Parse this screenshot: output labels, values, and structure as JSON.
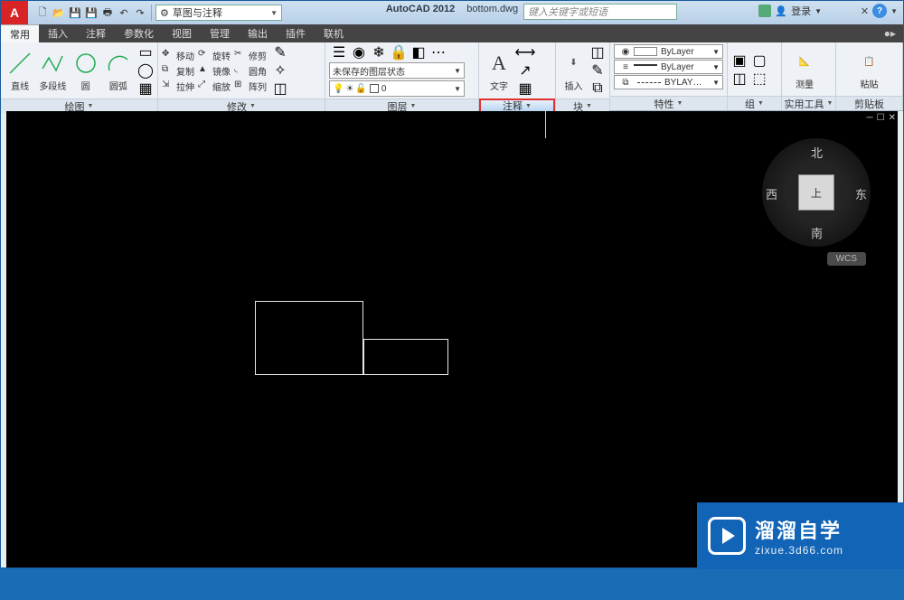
{
  "app": {
    "name": "AutoCAD 2012",
    "file": "bottom.dwg",
    "logo_letter": "A"
  },
  "search": {
    "placeholder": "键入关键字或短语"
  },
  "login": {
    "label": "登录"
  },
  "workspace": {
    "selected": "草图与注释"
  },
  "tabs": {
    "items": [
      "常用",
      "插入",
      "注释",
      "参数化",
      "视图",
      "管理",
      "输出",
      "插件",
      "联机"
    ],
    "active_index": 0,
    "play_icon": "●▸"
  },
  "ribbon": {
    "draw": {
      "title": "绘图",
      "big": [
        {
          "label": "直线"
        },
        {
          "label": "多段线"
        },
        {
          "label": "圆"
        },
        {
          "label": "圆弧"
        }
      ]
    },
    "modify": {
      "title": "修改",
      "items": [
        {
          "label": "移动"
        },
        {
          "label": "旋转"
        },
        {
          "label": "修剪"
        },
        {
          "label": "复制"
        },
        {
          "label": "镜像"
        },
        {
          "label": "圆角"
        },
        {
          "label": "拉伸"
        },
        {
          "label": "缩放"
        },
        {
          "label": "阵列"
        }
      ]
    },
    "layer": {
      "title": "图层",
      "state": "未保存的图层状态",
      "current": "0"
    },
    "annotate": {
      "title": "注释",
      "text_btn": "文字"
    },
    "block": {
      "title": "块",
      "insert_btn": "插入"
    },
    "properties": {
      "title": "特性",
      "rows": [
        {
          "swatch": "#ffffff",
          "label": "ByLayer"
        },
        {
          "swatch": "#000000",
          "label": "ByLayer",
          "line": true
        },
        {
          "swatch": "",
          "label": "BYLAY…"
        }
      ]
    },
    "group": {
      "title": "组"
    },
    "util": {
      "title": "实用工具",
      "measure": "测量"
    },
    "clip": {
      "title": "剪贴板",
      "paste": "粘贴"
    }
  },
  "viewcube": {
    "north": "北",
    "south": "南",
    "east": "东",
    "west": "西",
    "top": "上",
    "wcs": "WCS"
  },
  "watermark": {
    "cn": "溜溜自学",
    "url": "zixue.3d66.com"
  },
  "colors": {
    "highlight": "#e03030",
    "brand": "#1264b6"
  }
}
